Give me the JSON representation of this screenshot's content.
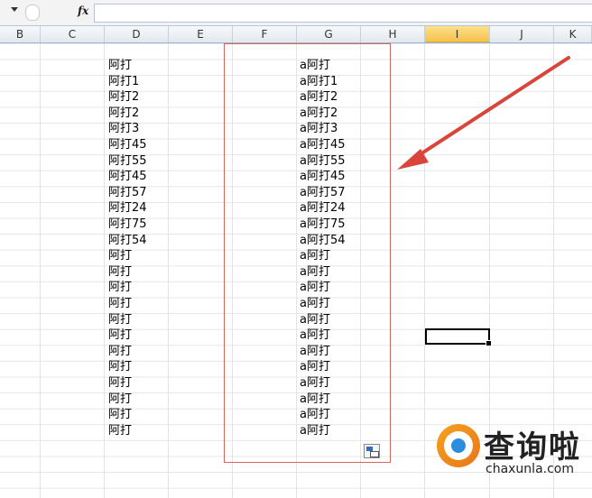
{
  "formula_bar": {
    "fx_label": "fx",
    "value": ""
  },
  "columns": [
    {
      "label": "B",
      "selected": false
    },
    {
      "label": "C",
      "selected": false
    },
    {
      "label": "D",
      "selected": false
    },
    {
      "label": "E",
      "selected": false
    },
    {
      "label": "F",
      "selected": false
    },
    {
      "label": "G",
      "selected": false
    },
    {
      "label": "H",
      "selected": false
    },
    {
      "label": "I",
      "selected": true
    },
    {
      "label": "J",
      "selected": false
    },
    {
      "label": "K",
      "selected": false
    }
  ],
  "column_d": [
    "阿打",
    "阿打1",
    "阿打2",
    "阿打2",
    "阿打3",
    "阿打45",
    "阿打55",
    "阿打45",
    "阿打57",
    "阿打24",
    "阿打75",
    "阿打54",
    "阿打",
    "阿打",
    "阿打",
    "阿打",
    "阿打",
    "阿打",
    "阿打",
    "阿打",
    "阿打",
    "阿打",
    "阿打",
    "阿打"
  ],
  "column_g": [
    "a阿打",
    "a阿打1",
    "a阿打2",
    "a阿打2",
    "a阿打3",
    "a阿打45",
    "a阿打55",
    "a阿打45",
    "a阿打57",
    "a阿打24",
    "a阿打75",
    "a阿打54",
    "a阿打",
    "a阿打",
    "a阿打",
    "a阿打",
    "a阿打",
    "a阿打",
    "a阿打",
    "a阿打",
    "a阿打",
    "a阿打",
    "a阿打",
    "a阿打"
  ],
  "watermark": {
    "title": "查询啦",
    "subtitle": "chaxunla.com"
  },
  "colors": {
    "annotation": "#d9453b",
    "selected_header": "#f5c24c"
  }
}
